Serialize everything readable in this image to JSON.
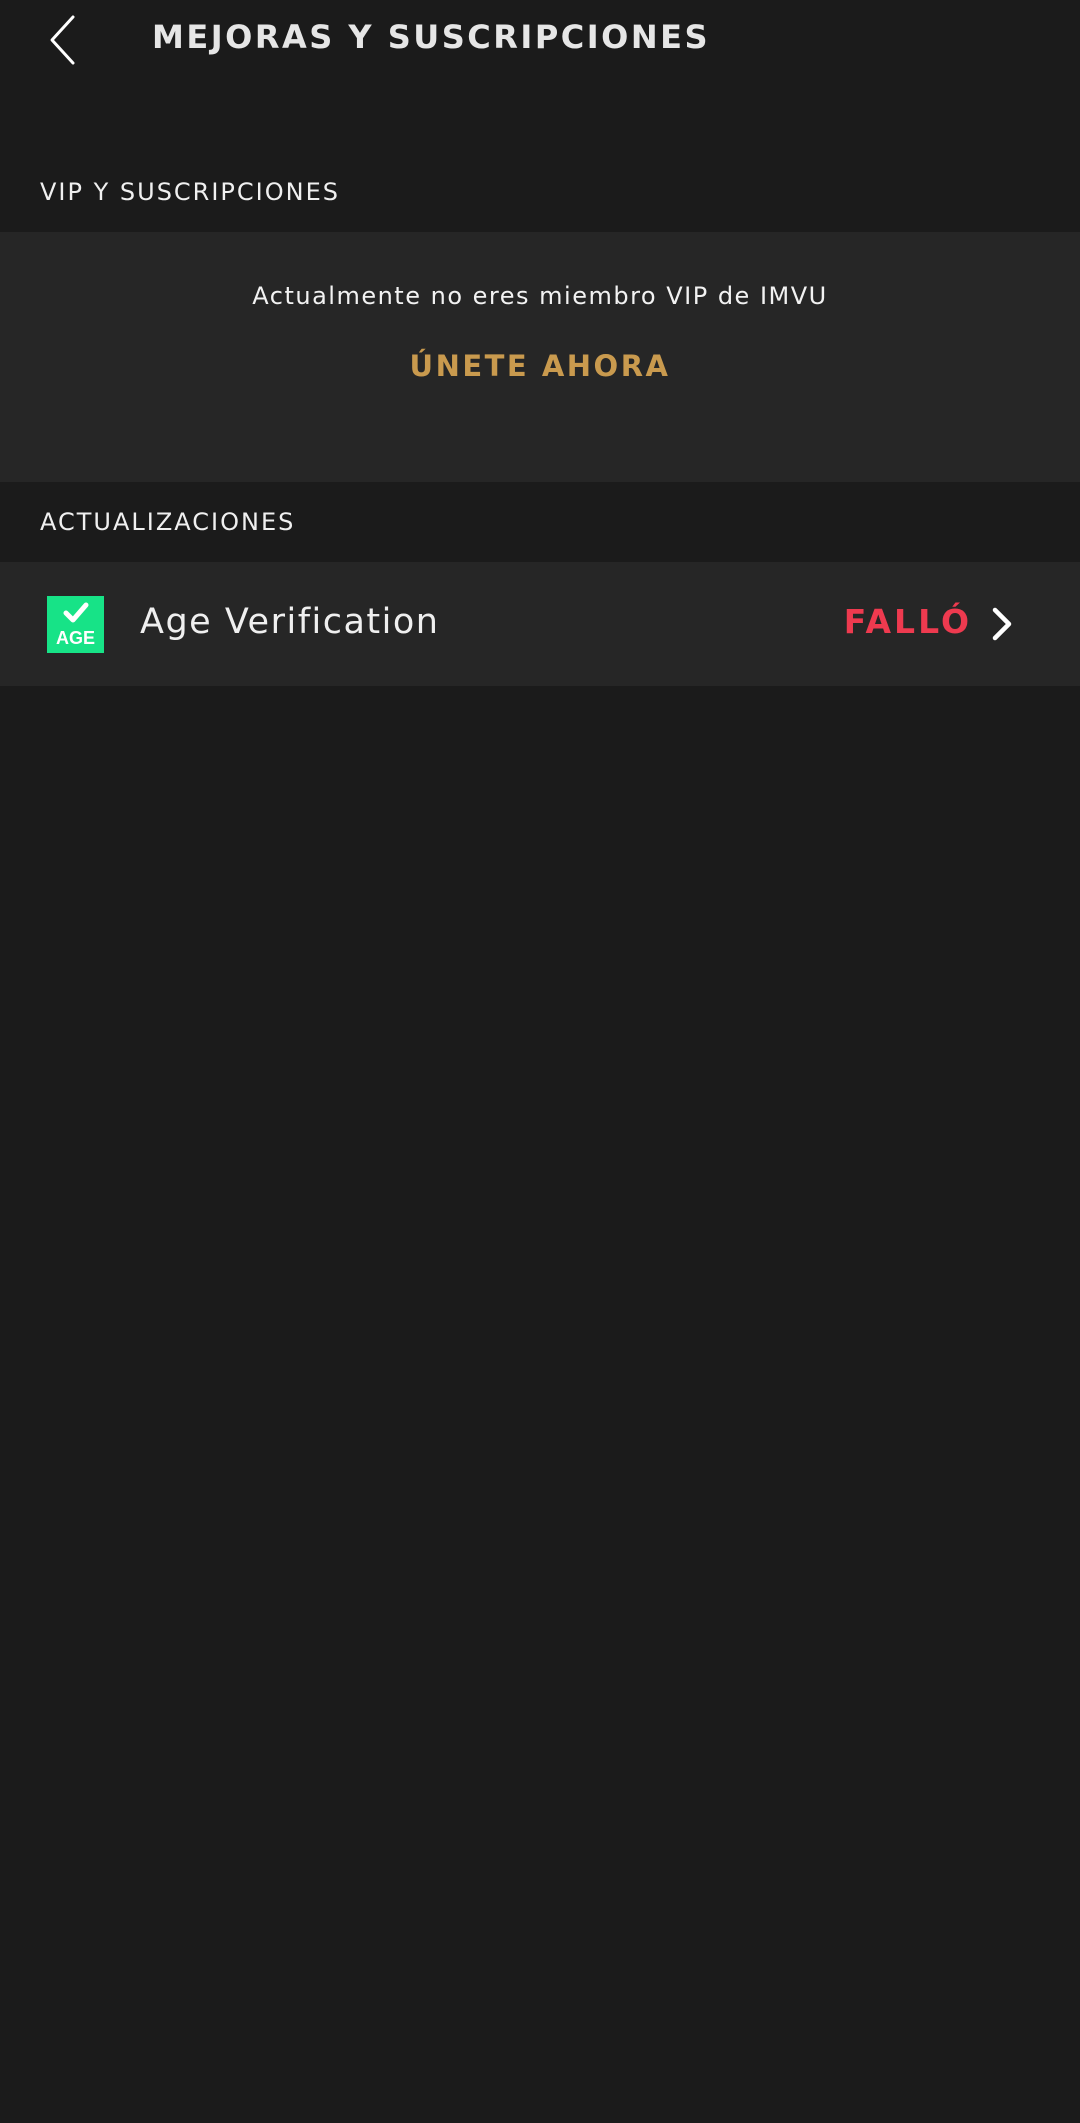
{
  "header": {
    "back_icon": "chevron-left-icon",
    "title": "MEJORAS Y SUSCRIPCIONES"
  },
  "vip_section": {
    "label": "VIP Y SUSCRIPCIONES",
    "status_text": "Actualmente no eres miembro VIP de IMVU",
    "join_label": "ÚNETE AHORA",
    "join_color": "#c99a4e"
  },
  "updates_section": {
    "label": "ACTUALIZACIONES",
    "items": [
      {
        "icon": "age-verification-icon",
        "icon_text": "AGE",
        "label": "Age Verification",
        "status": "FALLÓ",
        "status_color": "#ee3a4f",
        "chevron_icon": "chevron-right-icon"
      }
    ]
  },
  "colors": {
    "background": "#1b1b1b",
    "card": "#262626",
    "age_icon_green": "#17e387"
  }
}
